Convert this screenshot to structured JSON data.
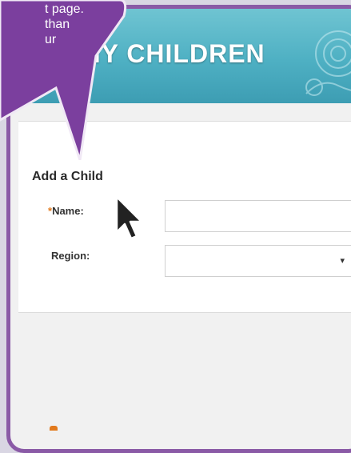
{
  "banner": {
    "title": "MY CHILDREN"
  },
  "callout": {
    "lines": [
      "t page.",
      "than",
      "ur"
    ]
  },
  "form": {
    "heading": "Add a Child",
    "required_mark": "*",
    "name_label": "Name:",
    "name_value": "",
    "region_label": "Region:",
    "region_value": ""
  },
  "icons": {
    "dropdown": "chevron-down-icon",
    "cursor": "mouse-pointer-icon"
  },
  "colors": {
    "frame": "#8a5aa6",
    "banner": "#4eb0c3",
    "callout": "#7b3f9e",
    "required": "#e27a1d"
  }
}
